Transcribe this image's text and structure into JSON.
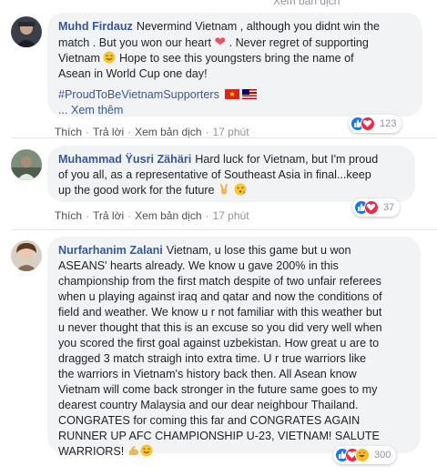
{
  "header": {
    "partial_text": "Xem bản dịch"
  },
  "comments": [
    {
      "author": "Muhd Firdauz",
      "text_lines": [
        "Nevermind Vietnam , although you didnt win the",
        "match . But you won our heart",
        ". Never regret of supporting",
        "Vietnam",
        "Hope to see this youngsters bring the name of",
        "Asean in World Cup one day!"
      ],
      "hashtag": "#ProudToBeVietnamSupporters",
      "see_more": "... Xem thêm",
      "actions": {
        "like": "Thích",
        "reply": "Trả lời",
        "translate": "Xem bản dịch",
        "time": "17 phút"
      },
      "reactions": {
        "count": "123",
        "types": [
          "like",
          "love"
        ]
      }
    },
    {
      "author": "Muhammad Ÿusri Zähäri",
      "text_lines": [
        "Hard luck for Vietnam, but I'm proud",
        "of you all, as a representative of Southeast Asia in final...keep",
        "up the good work for the future"
      ],
      "actions": {
        "like": "Thích",
        "reply": "Trả lời",
        "translate": "Xem bản dịch",
        "time": "17 phút"
      },
      "reactions": {
        "count": "37",
        "types": [
          "like",
          "love"
        ]
      }
    },
    {
      "author": "Nurfarhanim Zalani",
      "text_lines": [
        "Vietnam, u lose this game but u won",
        "ASEANS' hearts already. We know u gave 200% in this",
        "championship from the first match despite of two unfair referees",
        "when u playing against iraq and qatar and now the conditions of",
        "field and weather. We know u r not familiar with this weather but",
        "u never thought that this is an excuse so you did very well when",
        "you scored the first goal against uzbekistan. How great u are to",
        "dragged 3 match straigh into extra time. U r true warriors like",
        "the warriors in Vietnam's history back then. All Asean know",
        "Vietnam will come back stronger in the future same goes to my",
        "dearest country Malaysia and our dear neighbour Thailand.",
        "CONGRATES for coming this far and CONGRATES AGAIN",
        "RUNNER UP AFC CHAMPIONSHIP U-23, VIETNAM! SALUTE",
        "WARRIORS!"
      ],
      "actions": {
        "like": "Thích",
        "reply": "Trả lời",
        "translate": "Xem bản dịch",
        "time": "17 phút"
      },
      "reactions": {
        "count": "300",
        "types": [
          "like",
          "love",
          "haha"
        ]
      }
    }
  ]
}
